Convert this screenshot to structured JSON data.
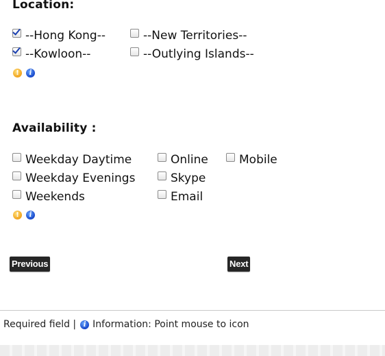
{
  "location": {
    "heading": "Location:",
    "options": [
      {
        "label": "--Hong Kong--",
        "checked": true
      },
      {
        "label": "--New Territories--",
        "checked": false
      },
      {
        "label": "--Kowloon--",
        "checked": true
      },
      {
        "label": "--Outlying Islands--",
        "checked": false
      }
    ]
  },
  "availability": {
    "heading": "Availability :",
    "options": [
      {
        "label": "Weekday Daytime",
        "checked": false
      },
      {
        "label": "Online",
        "checked": false
      },
      {
        "label": "Mobile",
        "checked": false
      },
      {
        "label": "Weekday Evenings",
        "checked": false
      },
      {
        "label": "Skype",
        "checked": false
      },
      {
        "label": "Weekends",
        "checked": false
      },
      {
        "label": "Email",
        "checked": false
      }
    ]
  },
  "icons": {
    "warning": "warning-icon",
    "info": "info-icon"
  },
  "buttons": {
    "previous": "Previous",
    "next": "Next"
  },
  "footer": {
    "required": "Required field |",
    "info": "Information: Point mouse to icon"
  }
}
